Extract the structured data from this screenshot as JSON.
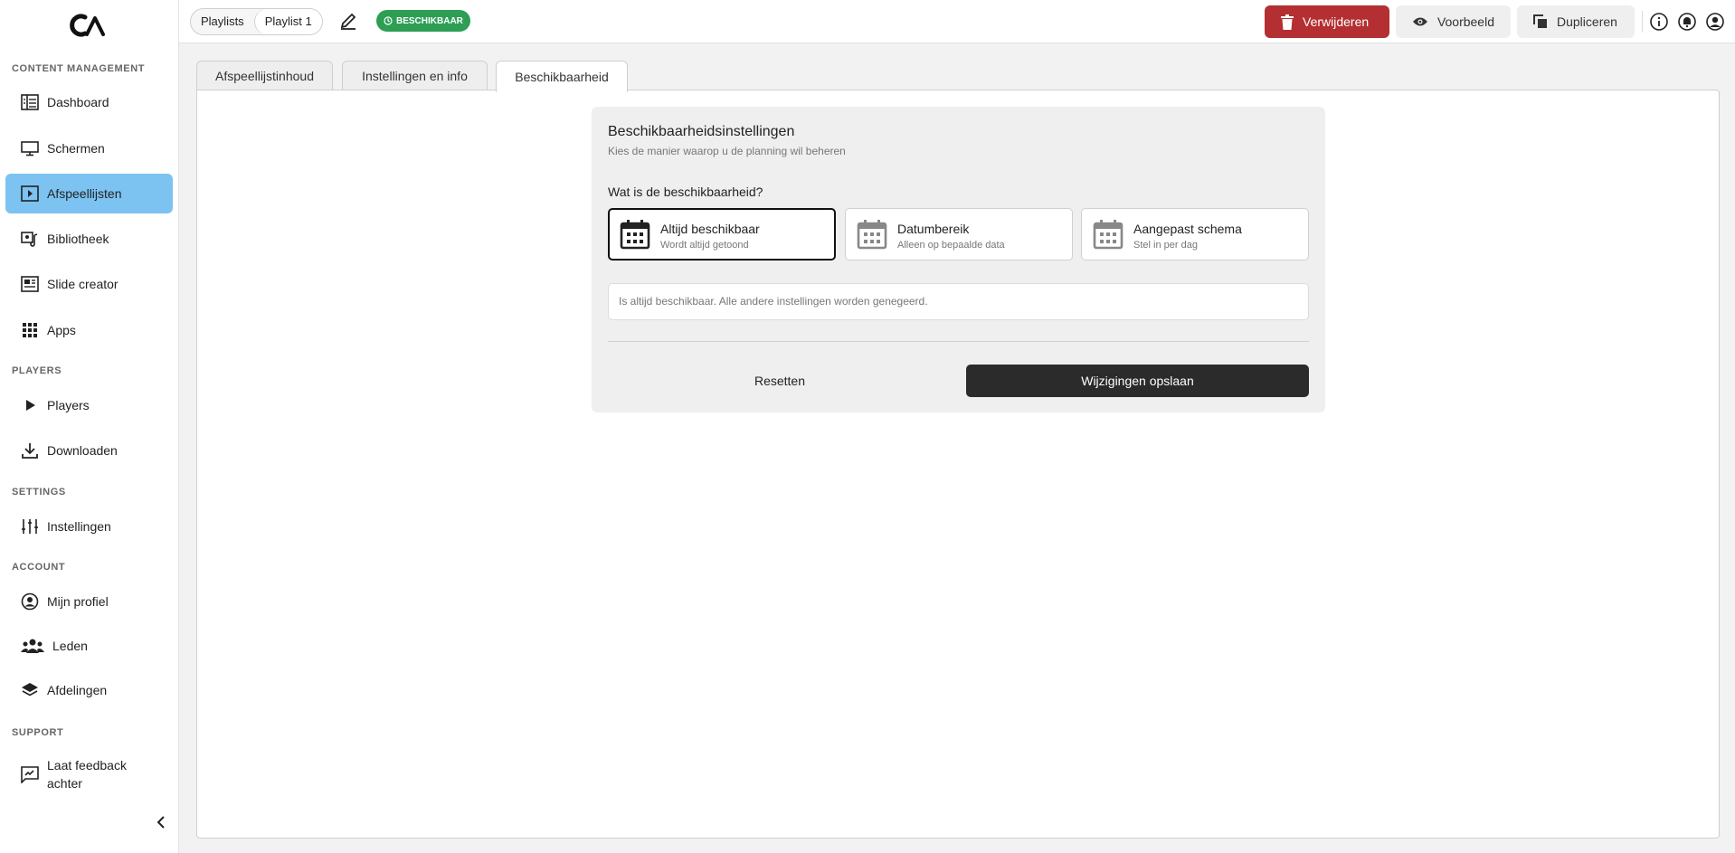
{
  "sidebar": {
    "sections": {
      "content": "CONTENT MANAGEMENT",
      "players": "PLAYERS",
      "settings": "SETTINGS",
      "account": "ACCOUNT",
      "support": "SUPPORT"
    },
    "items": {
      "dashboard": "Dashboard",
      "screens": "Schermen",
      "playlists": "Afspeellijsten",
      "library": "Bibliotheek",
      "slide_creator": "Slide creator",
      "apps": "Apps",
      "players": "Players",
      "downloads": "Downloaden",
      "settings": "Instellingen",
      "profile": "Mijn profiel",
      "members": "Leden",
      "departments": "Afdelingen",
      "feedback": "Laat feedback achter"
    },
    "active_item": "playlists"
  },
  "header": {
    "breadcrumb": [
      "Playlists",
      "Playlist 1"
    ],
    "status_badge": "BESCHIKBAAR",
    "delete_label": "Verwijderen",
    "preview_label": "Voorbeeld",
    "duplicate_label": "Dupliceren"
  },
  "tabs": [
    "Afspeellijstinhoud",
    "Instellingen en info",
    "Beschikbaarheid"
  ],
  "active_tab": 2,
  "availability": {
    "title": "Beschikbaarheidsinstellingen",
    "subtitle": "Kies de manier waarop u de planning wil beheren",
    "question": "Wat is de beschikbaarheid?",
    "options": [
      {
        "title": "Altijd beschikbaar",
        "sub": "Wordt altijd getoond",
        "selected": true
      },
      {
        "title": "Datumbereik",
        "sub": "Alleen op bepaalde data",
        "selected": false
      },
      {
        "title": "Aangepast schema",
        "sub": "Stel in per dag",
        "selected": false
      }
    ],
    "info": "Is altijd beschikbaar. Alle andere instellingen worden genegeerd.",
    "reset_label": "Resetten",
    "save_label": "Wijzigingen opslaan"
  },
  "colors": {
    "active_nav": "#7cc3f2",
    "danger": "#b32f31",
    "badge": "#2e9e55",
    "primary_dark": "#2b2b2b"
  }
}
